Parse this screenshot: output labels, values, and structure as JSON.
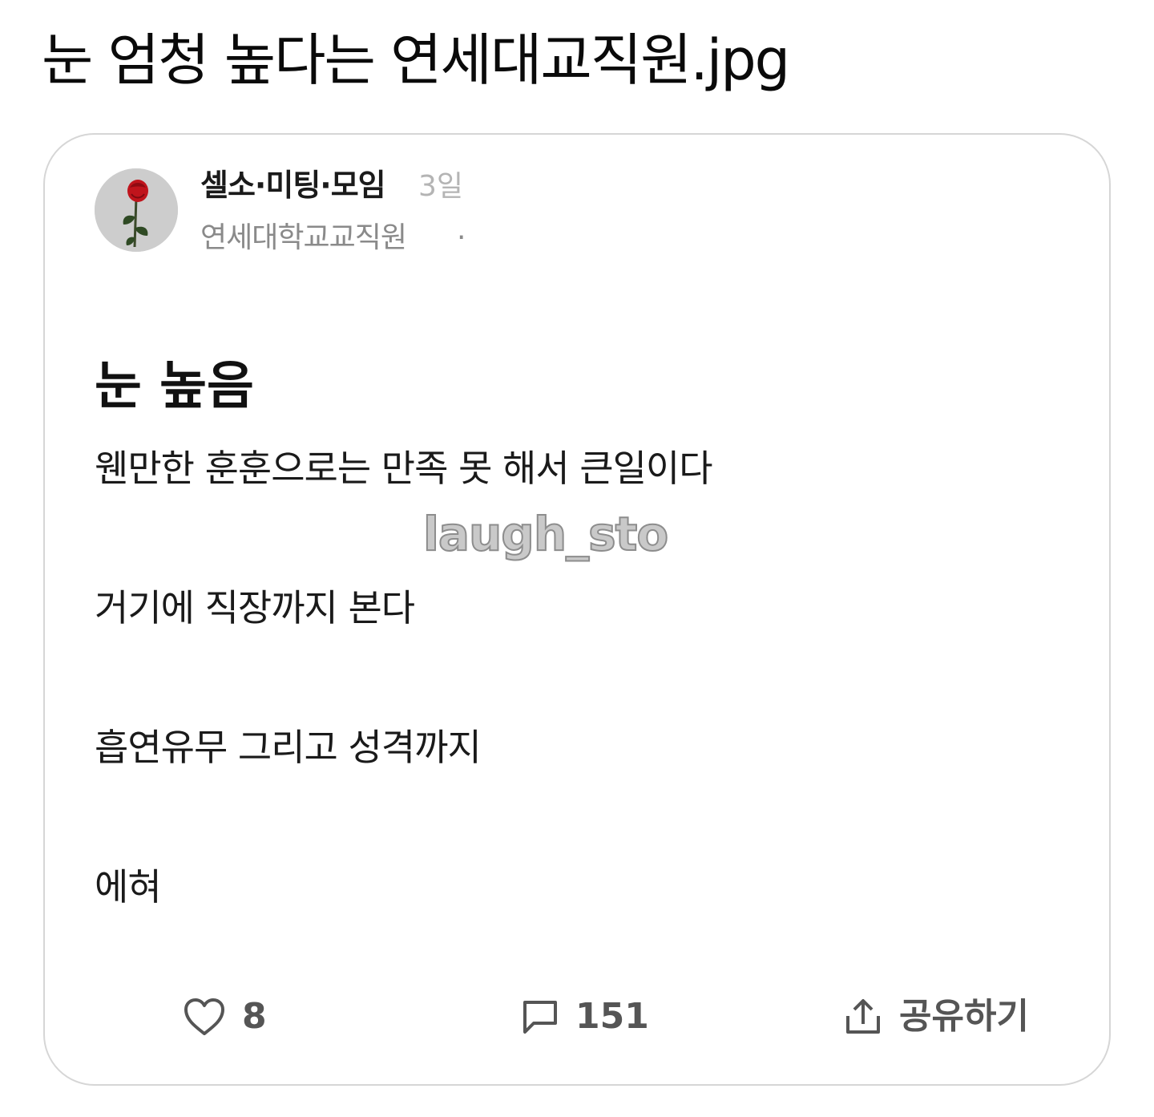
{
  "page_title": "눈 엄청 높다는 연세대교직원.jpg",
  "post": {
    "board_name": "셀소·미팅·모임",
    "time": "3일",
    "author": "연세대학교교직원",
    "author_separator": "·",
    "heading": "눈 높음",
    "lines": [
      "웬만한 훈훈으로는 만족 못 해서 큰일이다",
      "거기에 직장까지 본다",
      "흡연유무 그리고 성격까지",
      "에혀"
    ]
  },
  "watermark": "laugh_sto",
  "actions": {
    "like_count": "8",
    "comment_count": "151",
    "share_label": "공유하기"
  },
  "colors": {
    "card_border": "#d6d6d6",
    "muted_text": "#8a8a8a",
    "time_text": "#b4b4b4",
    "action_text": "#555555",
    "avatar_rose": "#c0141c"
  },
  "icons": {
    "like": "heart-outline-icon",
    "comment": "speech-bubble-icon",
    "share": "share-upload-icon",
    "avatar": "rose-avatar"
  }
}
